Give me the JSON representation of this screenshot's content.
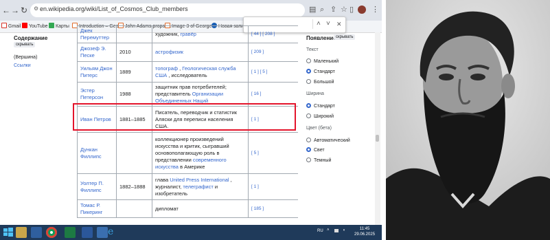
{
  "browser": {
    "url": "en.wikipedia.org/wiki/List_of_Cosmos_Club_members",
    "bookmarks": [
      "Gmail",
      "YouTube",
      "Карты",
      "Introduction – Geor...",
      "John Adams propos...",
      "Image 3 of George...",
      "Новая запись"
    ],
    "find_up": "˄",
    "find_down": "˅",
    "find_close": "✕"
  },
  "sidebar_left": {
    "contents_title": "Содержание",
    "hide_label": "скрывать",
    "top_label": "(Вершина)",
    "sources_label": "Ссылки"
  },
  "table": {
    "rows": [
      {
        "name": "Джек Перемуттер",
        "years": "",
        "desc_pre": "художник, ",
        "desc_link": "гравёр",
        "ref": "[ 44 ] [ 208 ]"
      },
      {
        "name": "Джозеф Э. Песке",
        "years": "2010",
        "desc_pre": "",
        "desc_link": "астрофизик",
        "ref": "[ 209 ]"
      },
      {
        "name": "Уильям Джон Питерс",
        "years": "1889",
        "desc_link1": "топограф",
        "desc_sep": " , ",
        "desc_link2": "Геологическая служба США",
        "desc_post": " , исследователь",
        "ref": "[ 1 ] [ 5 ]"
      },
      {
        "name": "Эстер Петерсон",
        "years": "1988",
        "desc_pre": "защитник прав потребителей; представитель ",
        "desc_link": "Организации Объединенных Наций",
        "ref": "[ 16 ]"
      },
      {
        "name": "Иван Петров",
        "years": "1881–1885",
        "desc_pre": "Писатель, переводчик и статистик Аляски для переписи населения США.",
        "ref": "[ 1 ]"
      },
      {
        "name": "Дункан Филлипс",
        "years": "",
        "desc_pre": "коллекционер произведений искусства и критик, сыгравший основополагающую роль в представлении ",
        "desc_link": "современного искусства",
        "desc_post": " в Америке",
        "ref": "[ 5 ]"
      },
      {
        "name": "Уолтер П. Филлипс",
        "years": "1882–1888",
        "desc_pre": "глава ",
        "desc_link1": "United Press International",
        "desc_mid": " , журналист, ",
        "desc_link2": "телеграфист",
        "desc_post": " и изобретатель",
        "ref": "[ 1 ]"
      },
      {
        "name": "Томас Р. Пикеринг",
        "years": "",
        "desc_pre": "дипломат",
        "ref": "[ 185 ]"
      }
    ]
  },
  "panel_right": {
    "title": "Появление",
    "hide_label": "скрывать",
    "text_group": "Текст",
    "text_options": [
      "Маленький",
      "Стандарт",
      "Большой"
    ],
    "width_group": "Ширина",
    "width_options": [
      "Стандарт",
      "Широкий"
    ],
    "color_group": "Цвет (бета)",
    "color_options": [
      "Автоматический",
      "Свет",
      "Темный"
    ]
  },
  "taskbar": {
    "lang": "RU",
    "time": "11:45",
    "date": "29.06.2025"
  },
  "colors": {
    "link": "#3366cc",
    "highlight": "#e3132a",
    "taskbar": "#1f3a5a"
  }
}
